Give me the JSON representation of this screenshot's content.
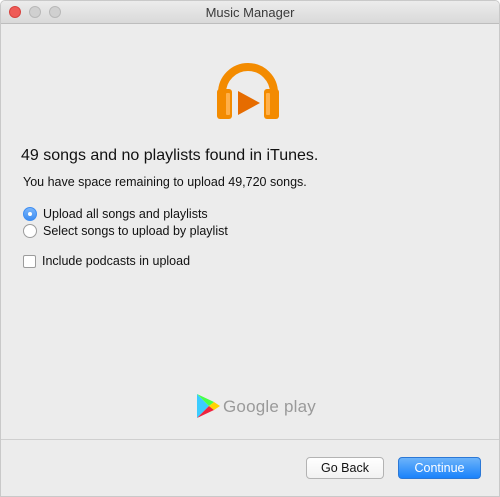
{
  "window": {
    "title": "Music Manager"
  },
  "icons": {
    "app_icon": "headphones-icon",
    "brand_logo": "google-play-logo-icon"
  },
  "colors": {
    "accent": "#1a82fb",
    "headphones": "#f38b00"
  },
  "main": {
    "headline": "49 songs and no playlists found in iTunes.",
    "subline": "You have space remaining to upload 49,720 songs.",
    "options": [
      {
        "label": "Upload all songs and playlists",
        "selected": true
      },
      {
        "label": "Select songs to upload by playlist",
        "selected": false
      }
    ],
    "include_podcasts": {
      "label": "Include podcasts in upload",
      "checked": false
    }
  },
  "branding": {
    "text": "Google play"
  },
  "footer": {
    "back_label": "Go Back",
    "continue_label": "Continue"
  }
}
